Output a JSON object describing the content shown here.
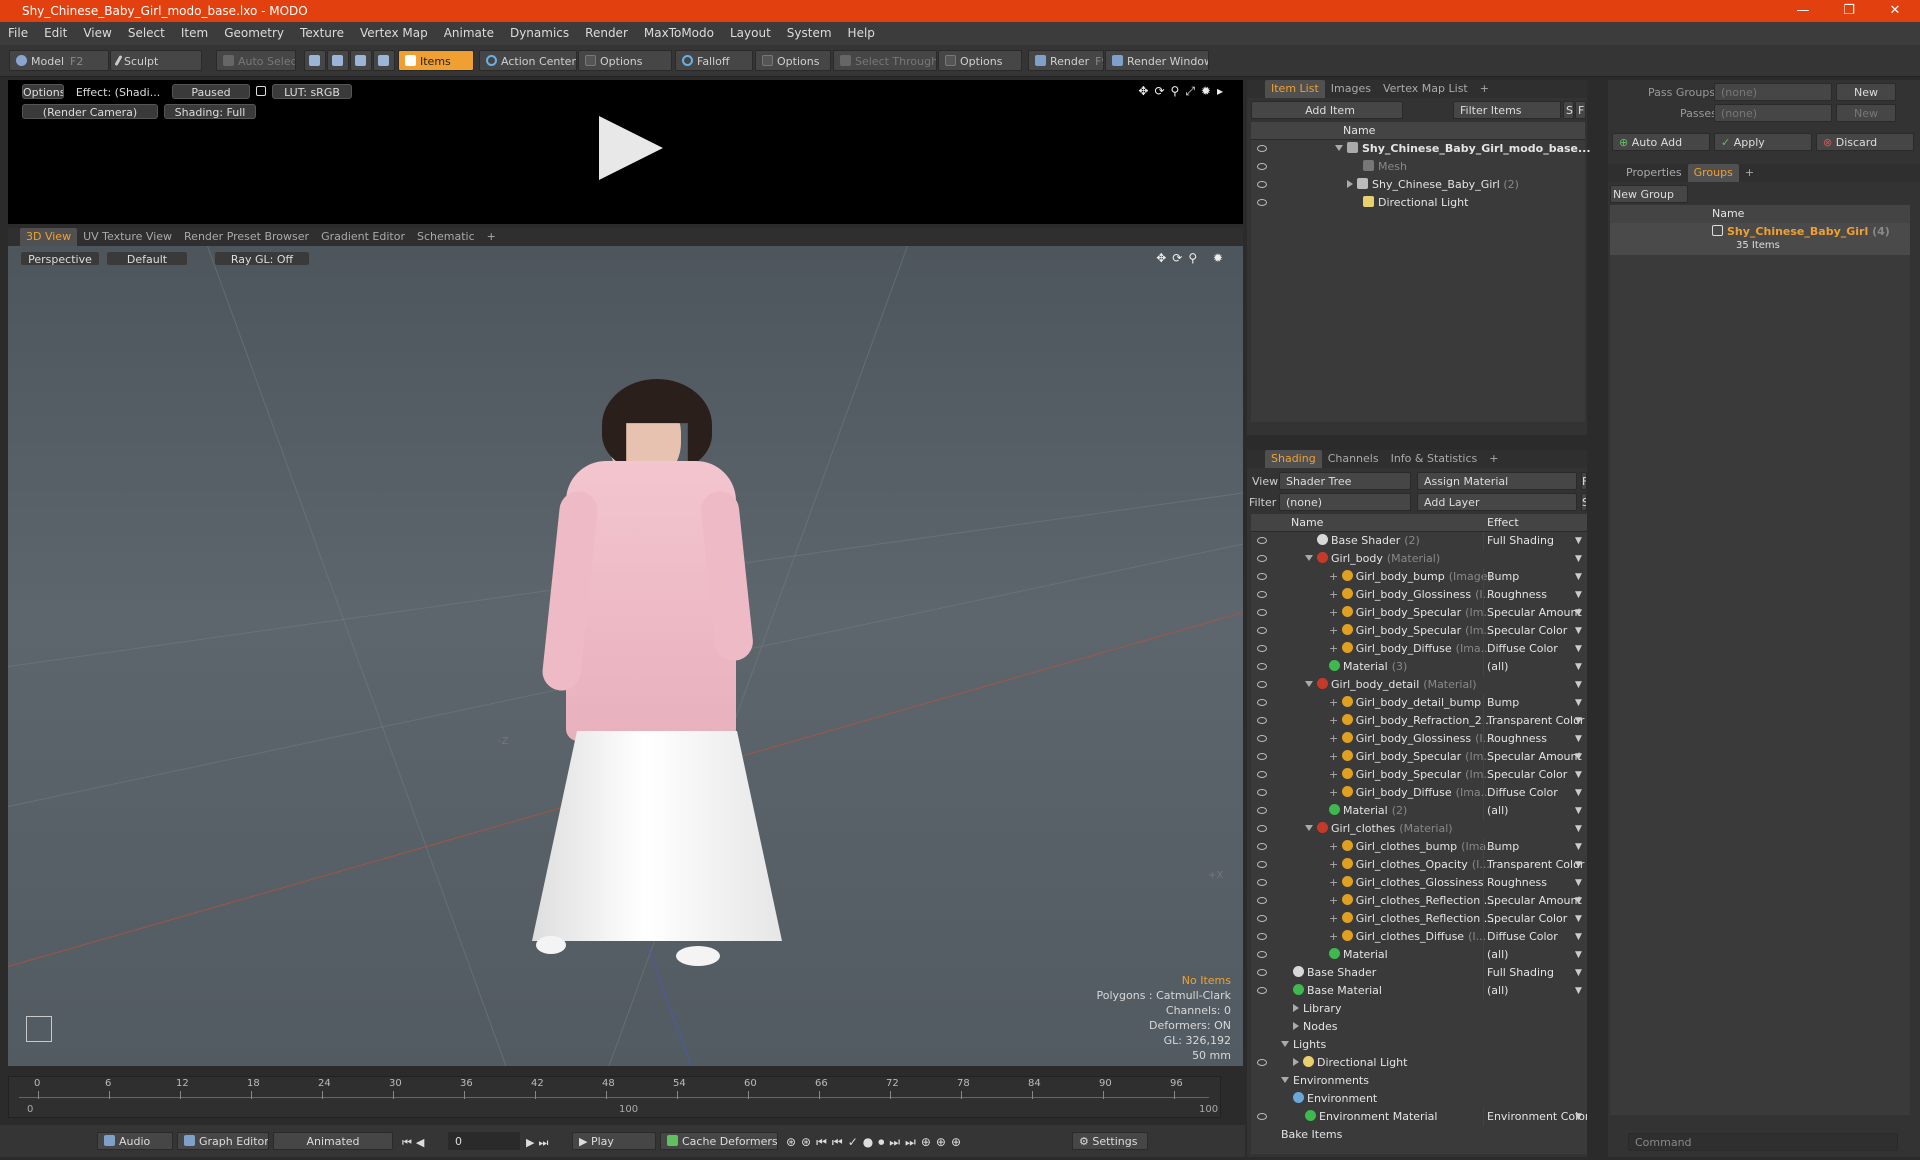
{
  "window": {
    "title": "Shy_Chinese_Baby_Girl_modo_base.lxo - MODO",
    "minimize": "—",
    "maximize": "❐",
    "close": "✕"
  },
  "menu": [
    "File",
    "Edit",
    "View",
    "Select",
    "Item",
    "Geometry",
    "Texture",
    "Vertex Map",
    "Animate",
    "Dynamics",
    "Render",
    "MaxToModo",
    "Layout",
    "System",
    "Help"
  ],
  "toolbar": {
    "model": "Model",
    "model_key": "F2",
    "sculpt": "Sculpt",
    "auto_select": "Auto Select",
    "items": "Items",
    "action_center": "Action Center",
    "options1": "Options",
    "falloff": "Falloff",
    "options2": "Options",
    "select_through": "Select Through",
    "options3": "Options",
    "render": "Render",
    "render_key": "F9",
    "render_window": "Render Window"
  },
  "preview": {
    "options": "Options",
    "effect": "Effect: (Shadi...",
    "paused": "Paused",
    "lut": "LUT: sRGB",
    "camera": "(Render Camera)",
    "shading": "Shading: Full"
  },
  "view_tabs": [
    "3D View",
    "UV Texture View",
    "Render Preset Browser",
    "Gradient Editor",
    "Schematic",
    "+"
  ],
  "viewport": {
    "perspective": "Perspective",
    "default": "Default",
    "raygl": "Ray GL: Off",
    "axis_z": "-Z",
    "axis_x": "+X",
    "stats": [
      "No Items",
      "Polygons : Catmull-Clark",
      "Channels: 0",
      "Deformers: ON",
      "GL: 326,192",
      "50 mm"
    ]
  },
  "timeline": {
    "ticks": [
      "0",
      "6",
      "12",
      "18",
      "24",
      "30",
      "36",
      "42",
      "48",
      "54",
      "60",
      "66",
      "72",
      "78",
      "84",
      "90",
      "96"
    ],
    "range_start": "0",
    "range_mid": "100",
    "range_end": "100"
  },
  "bottom": {
    "audio": "Audio",
    "graph_editor": "Graph Editor",
    "animated": "Animated",
    "frame": "0",
    "play": "Play",
    "cache": "Cache Deformers",
    "settings": "Settings"
  },
  "item_list": {
    "tabs": [
      "Item List",
      "Images",
      "Vertex Map List",
      "+"
    ],
    "add_item": "Add Item",
    "filter": "Filter Items",
    "s": "S",
    "f": "F",
    "col_name": "Name",
    "rows": [
      {
        "name": "Shy_Chinese_Baby_Girl_modo_base...",
        "sub": ""
      },
      {
        "name": "Mesh",
        "sub": ""
      },
      {
        "name": "Shy_Chinese_Baby_Girl",
        "sub": "(2)"
      },
      {
        "name": "Directional Light",
        "sub": ""
      }
    ]
  },
  "shading": {
    "tabs": [
      "Shading",
      "Channels",
      "Info & Statistics",
      "+"
    ],
    "view_label": "View",
    "view_value": "Shader Tree",
    "assign": "Assign Material",
    "f": "F",
    "filter_label": "Filter",
    "filter_value": "(none)",
    "add_layer": "Add Layer",
    "s": "S",
    "col_name": "Name",
    "col_effect": "Effect",
    "rows": [
      {
        "name": "Base Shader",
        "sub": "(2)",
        "effect": "Full Shading",
        "indent": 3,
        "icon": "shader"
      },
      {
        "name": "Girl_body",
        "sub": "(Material)",
        "effect": "",
        "indent": 2,
        "icon": "mat"
      },
      {
        "name": "Girl_body_bump",
        "sub": "(Image)",
        "effect": "Bump",
        "indent": 4,
        "icon": "img"
      },
      {
        "name": "Girl_body_Glossiness",
        "sub": "(I...",
        "effect": "Roughness",
        "indent": 4,
        "icon": "img"
      },
      {
        "name": "Girl_body_Specular",
        "sub": "(Im...",
        "effect": "Specular Amount",
        "indent": 4,
        "icon": "img"
      },
      {
        "name": "Girl_body_Specular",
        "sub": "(Im...",
        "effect": "Specular Color",
        "indent": 4,
        "icon": "img"
      },
      {
        "name": "Girl_body_Diffuse",
        "sub": "(Ima...",
        "effect": "Diffuse Color",
        "indent": 4,
        "icon": "img"
      },
      {
        "name": "Material",
        "sub": "(3)",
        "effect": "(all)",
        "indent": 4,
        "icon": "green"
      },
      {
        "name": "Girl_body_detail",
        "sub": "(Material)",
        "effect": "",
        "indent": 2,
        "icon": "mat"
      },
      {
        "name": "Girl_body_detail_bump",
        "sub": "",
        "effect": "Bump",
        "indent": 4,
        "icon": "img"
      },
      {
        "name": "Girl_body_Refraction_2...",
        "sub": "",
        "effect": "Transparent Color",
        "indent": 4,
        "icon": "img"
      },
      {
        "name": "Girl_body_Glossiness",
        "sub": "(I...",
        "effect": "Roughness",
        "indent": 4,
        "icon": "img"
      },
      {
        "name": "Girl_body_Specular",
        "sub": "(Im...",
        "effect": "Specular Amount",
        "indent": 4,
        "icon": "img"
      },
      {
        "name": "Girl_body_Specular",
        "sub": "(Im...",
        "effect": "Specular Color",
        "indent": 4,
        "icon": "img"
      },
      {
        "name": "Girl_body_Diffuse",
        "sub": "(Ima...",
        "effect": "Diffuse Color",
        "indent": 4,
        "icon": "img"
      },
      {
        "name": "Material",
        "sub": "(2)",
        "effect": "(all)",
        "indent": 4,
        "icon": "green"
      },
      {
        "name": "Girl_clothes",
        "sub": "(Material)",
        "effect": "",
        "indent": 2,
        "icon": "mat"
      },
      {
        "name": "Girl_clothes_bump",
        "sub": "(Ima...",
        "effect": "Bump",
        "indent": 4,
        "icon": "img"
      },
      {
        "name": "Girl_clothes_Opacity",
        "sub": "(I...",
        "effect": "Transparent Color",
        "indent": 4,
        "icon": "img"
      },
      {
        "name": "Girl_clothes_Glossiness",
        "sub": "",
        "effect": "Roughness",
        "indent": 4,
        "icon": "img"
      },
      {
        "name": "Girl_clothes_Reflection ...",
        "sub": "",
        "effect": "Specular Amount",
        "indent": 4,
        "icon": "img"
      },
      {
        "name": "Girl_clothes_Reflection ...",
        "sub": "",
        "effect": "Specular Color",
        "indent": 4,
        "icon": "img"
      },
      {
        "name": "Girl_clothes_Diffuse",
        "sub": "(I...",
        "effect": "Diffuse Color",
        "indent": 4,
        "icon": "img"
      },
      {
        "name": "Material",
        "sub": "",
        "effect": "(all)",
        "indent": 4,
        "icon": "green"
      },
      {
        "name": "Base Shader",
        "sub": "",
        "effect": "Full Shading",
        "indent": 1,
        "icon": "shader"
      },
      {
        "name": "Base Material",
        "sub": "",
        "effect": "(all)",
        "indent": 1,
        "icon": "green"
      },
      {
        "name": "Library",
        "sub": "",
        "effect": "",
        "indent": 1,
        "icon": "folder"
      },
      {
        "name": "Nodes",
        "sub": "",
        "effect": "",
        "indent": 1,
        "icon": "folder"
      },
      {
        "name": "Lights",
        "sub": "",
        "effect": "",
        "indent": 0,
        "icon": "none"
      },
      {
        "name": "Directional Light",
        "sub": "",
        "effect": "",
        "indent": 1,
        "icon": "light"
      },
      {
        "name": "Environments",
        "sub": "",
        "effect": "",
        "indent": 0,
        "icon": "none"
      },
      {
        "name": "Environment",
        "sub": "",
        "effect": "",
        "indent": 1,
        "icon": "env"
      },
      {
        "name": "Environment Material",
        "sub": "",
        "effect": "Environment Color",
        "indent": 2,
        "icon": "green"
      },
      {
        "name": "Bake Items",
        "sub": "",
        "effect": "",
        "indent": 0,
        "icon": "none"
      }
    ]
  },
  "groups_panel": {
    "pass_groups": "Pass Groups",
    "passes": "Passes",
    "none1": "(none)",
    "none2": "(none)",
    "new1": "New",
    "new2": "New",
    "auto_add": "Auto Add",
    "apply": "Apply",
    "discard": "Discard",
    "tabs": [
      "Properties",
      "Groups",
      "+"
    ],
    "new_group": "New Group",
    "col_name": "Name",
    "group_name": "Shy_Chinese_Baby_Girl",
    "group_count": "(4)",
    "group_items": "35 Items"
  },
  "command": {
    "placeholder": "Command"
  },
  "colors": {
    "accent": "#f0a030",
    "titlebar": "#e2400f"
  }
}
